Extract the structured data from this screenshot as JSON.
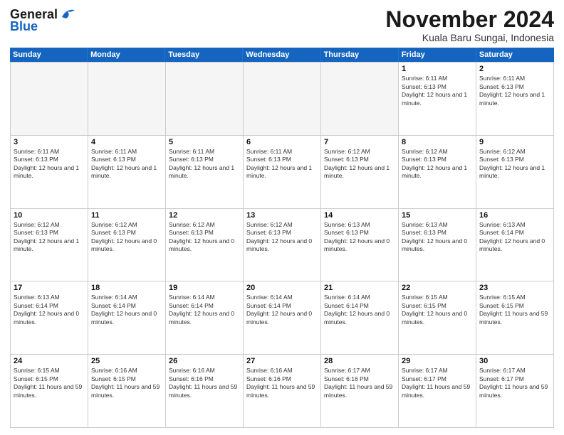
{
  "logo": {
    "general": "General",
    "blue": "Blue"
  },
  "header": {
    "month": "November 2024",
    "location": "Kuala Baru Sungai, Indonesia"
  },
  "days": [
    "Sunday",
    "Monday",
    "Tuesday",
    "Wednesday",
    "Thursday",
    "Friday",
    "Saturday"
  ],
  "weeks": [
    [
      {
        "day": "",
        "info": "",
        "empty": true
      },
      {
        "day": "",
        "info": "",
        "empty": true
      },
      {
        "day": "",
        "info": "",
        "empty": true
      },
      {
        "day": "",
        "info": "",
        "empty": true
      },
      {
        "day": "",
        "info": "",
        "empty": true
      },
      {
        "day": "1",
        "info": "Sunrise: 6:11 AM\nSunset: 6:13 PM\nDaylight: 12 hours and 1 minute.",
        "empty": false
      },
      {
        "day": "2",
        "info": "Sunrise: 6:11 AM\nSunset: 6:13 PM\nDaylight: 12 hours and 1 minute.",
        "empty": false
      }
    ],
    [
      {
        "day": "3",
        "info": "Sunrise: 6:11 AM\nSunset: 6:13 PM\nDaylight: 12 hours and 1 minute.",
        "empty": false
      },
      {
        "day": "4",
        "info": "Sunrise: 6:11 AM\nSunset: 6:13 PM\nDaylight: 12 hours and 1 minute.",
        "empty": false
      },
      {
        "day": "5",
        "info": "Sunrise: 6:11 AM\nSunset: 6:13 PM\nDaylight: 12 hours and 1 minute.",
        "empty": false
      },
      {
        "day": "6",
        "info": "Sunrise: 6:11 AM\nSunset: 6:13 PM\nDaylight: 12 hours and 1 minute.",
        "empty": false
      },
      {
        "day": "7",
        "info": "Sunrise: 6:12 AM\nSunset: 6:13 PM\nDaylight: 12 hours and 1 minute.",
        "empty": false
      },
      {
        "day": "8",
        "info": "Sunrise: 6:12 AM\nSunset: 6:13 PM\nDaylight: 12 hours and 1 minute.",
        "empty": false
      },
      {
        "day": "9",
        "info": "Sunrise: 6:12 AM\nSunset: 6:13 PM\nDaylight: 12 hours and 1 minute.",
        "empty": false
      }
    ],
    [
      {
        "day": "10",
        "info": "Sunrise: 6:12 AM\nSunset: 6:13 PM\nDaylight: 12 hours and 1 minute.",
        "empty": false
      },
      {
        "day": "11",
        "info": "Sunrise: 6:12 AM\nSunset: 6:13 PM\nDaylight: 12 hours and 0 minutes.",
        "empty": false
      },
      {
        "day": "12",
        "info": "Sunrise: 6:12 AM\nSunset: 6:13 PM\nDaylight: 12 hours and 0 minutes.",
        "empty": false
      },
      {
        "day": "13",
        "info": "Sunrise: 6:12 AM\nSunset: 6:13 PM\nDaylight: 12 hours and 0 minutes.",
        "empty": false
      },
      {
        "day": "14",
        "info": "Sunrise: 6:13 AM\nSunset: 6:13 PM\nDaylight: 12 hours and 0 minutes.",
        "empty": false
      },
      {
        "day": "15",
        "info": "Sunrise: 6:13 AM\nSunset: 6:13 PM\nDaylight: 12 hours and 0 minutes.",
        "empty": false
      },
      {
        "day": "16",
        "info": "Sunrise: 6:13 AM\nSunset: 6:14 PM\nDaylight: 12 hours and 0 minutes.",
        "empty": false
      }
    ],
    [
      {
        "day": "17",
        "info": "Sunrise: 6:13 AM\nSunset: 6:14 PM\nDaylight: 12 hours and 0 minutes.",
        "empty": false
      },
      {
        "day": "18",
        "info": "Sunrise: 6:14 AM\nSunset: 6:14 PM\nDaylight: 12 hours and 0 minutes.",
        "empty": false
      },
      {
        "day": "19",
        "info": "Sunrise: 6:14 AM\nSunset: 6:14 PM\nDaylight: 12 hours and 0 minutes.",
        "empty": false
      },
      {
        "day": "20",
        "info": "Sunrise: 6:14 AM\nSunset: 6:14 PM\nDaylight: 12 hours and 0 minutes.",
        "empty": false
      },
      {
        "day": "21",
        "info": "Sunrise: 6:14 AM\nSunset: 6:14 PM\nDaylight: 12 hours and 0 minutes.",
        "empty": false
      },
      {
        "day": "22",
        "info": "Sunrise: 6:15 AM\nSunset: 6:15 PM\nDaylight: 12 hours and 0 minutes.",
        "empty": false
      },
      {
        "day": "23",
        "info": "Sunrise: 6:15 AM\nSunset: 6:15 PM\nDaylight: 11 hours and 59 minutes.",
        "empty": false
      }
    ],
    [
      {
        "day": "24",
        "info": "Sunrise: 6:15 AM\nSunset: 6:15 PM\nDaylight: 11 hours and 59 minutes.",
        "empty": false
      },
      {
        "day": "25",
        "info": "Sunrise: 6:16 AM\nSunset: 6:15 PM\nDaylight: 11 hours and 59 minutes.",
        "empty": false
      },
      {
        "day": "26",
        "info": "Sunrise: 6:16 AM\nSunset: 6:16 PM\nDaylight: 11 hours and 59 minutes.",
        "empty": false
      },
      {
        "day": "27",
        "info": "Sunrise: 6:16 AM\nSunset: 6:16 PM\nDaylight: 11 hours and 59 minutes.",
        "empty": false
      },
      {
        "day": "28",
        "info": "Sunrise: 6:17 AM\nSunset: 6:16 PM\nDaylight: 11 hours and 59 minutes.",
        "empty": false
      },
      {
        "day": "29",
        "info": "Sunrise: 6:17 AM\nSunset: 6:17 PM\nDaylight: 11 hours and 59 minutes.",
        "empty": false
      },
      {
        "day": "30",
        "info": "Sunrise: 6:17 AM\nSunset: 6:17 PM\nDaylight: 11 hours and 59 minutes.",
        "empty": false
      }
    ]
  ]
}
